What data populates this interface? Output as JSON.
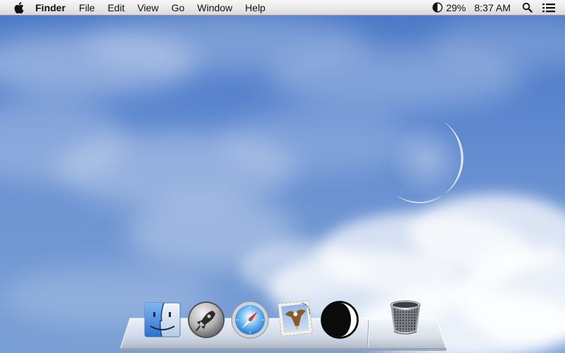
{
  "menubar": {
    "apple_icon": "apple-logo-icon",
    "app_name": "Finder",
    "items": [
      "File",
      "Edit",
      "View",
      "Go",
      "Window",
      "Help"
    ],
    "status": {
      "battery_icon": "half-circle-battery-icon",
      "battery_percent": "29%",
      "time": "8:37 AM",
      "search_icon": "magnifier-icon",
      "list_icon": "notification-list-icon"
    }
  },
  "dock": {
    "apps": [
      {
        "name": "Finder",
        "icon": "finder-face-icon"
      },
      {
        "name": "Launchpad",
        "icon": "rocket-icon"
      },
      {
        "name": "Safari",
        "icon": "compass-icon"
      },
      {
        "name": "Mail",
        "icon": "stamp-eagle-icon"
      },
      {
        "name": "Moon Phase App",
        "icon": "half-moon-icon"
      }
    ],
    "trash": {
      "icon": "trash-can-icon"
    }
  },
  "colors": {
    "sky_top": "#4a78c6",
    "sky_bottom": "#7ba0d6",
    "menubar": "#e9e9e9"
  }
}
